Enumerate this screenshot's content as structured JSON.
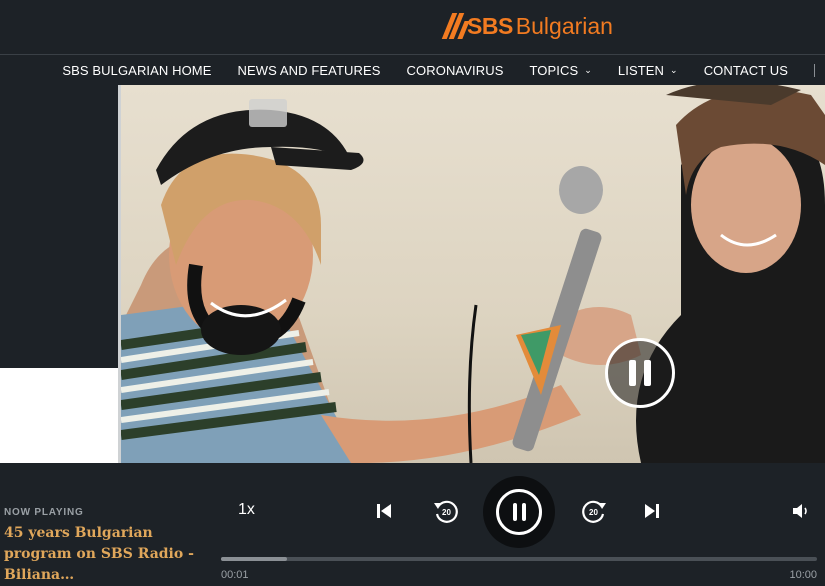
{
  "brand": {
    "sbs": "SBS",
    "language": "Bulgarian",
    "accent": "#f27b21"
  },
  "nav": {
    "items": [
      {
        "label": "SBS BULGARIAN HOME",
        "dropdown": false
      },
      {
        "label": "NEWS AND FEATURES",
        "dropdown": false
      },
      {
        "label": "CORONAVIRUS",
        "dropdown": false
      },
      {
        "label": "TOPICS",
        "dropdown": true
      },
      {
        "label": "LISTEN",
        "dropdown": true
      },
      {
        "label": "CONTACT US",
        "dropdown": false
      }
    ],
    "chevron": "⌄"
  },
  "player": {
    "now_playing_label": "NOW PLAYING",
    "title": "45 years Bulgarian program on SBS Radio - Biliana…",
    "speed": "1x",
    "rewind_seconds": "20",
    "forward_seconds": "20",
    "current_time": "00:01",
    "duration": "10:00",
    "progress_fraction": 0.11,
    "state": "playing"
  },
  "icons": {
    "logo": "sbs-logo-icon",
    "prev": "skip-previous-icon",
    "next": "skip-next-icon",
    "rewind": "rewind-20-icon",
    "forward": "forward-20-icon",
    "pause": "pause-icon",
    "volume": "volume-icon"
  }
}
